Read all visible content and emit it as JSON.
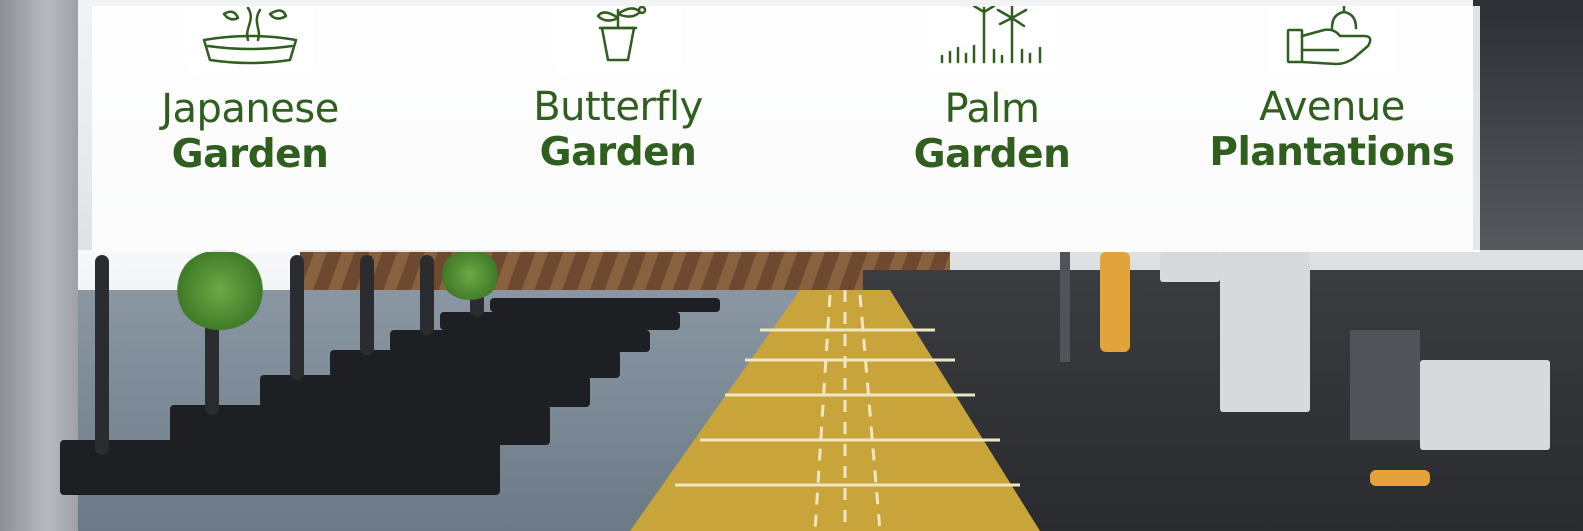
{
  "features": [
    {
      "line1": "Japanese",
      "line2": "Garden",
      "icon": "bonsai-icon"
    },
    {
      "line1": "Butterfly",
      "line2": "Garden",
      "icon": "potted-plant-icon"
    },
    {
      "line1": "Palm",
      "line2": "Garden",
      "icon": "palm-tree-icon"
    },
    {
      "line1": "Avenue",
      "line2": "Plantations",
      "icon": "hand-seedling-icon"
    }
  ],
  "colors": {
    "text_green": "#2f5e1f",
    "panel_bg": "#ffffff",
    "track_yellow": "#c9a43a"
  }
}
